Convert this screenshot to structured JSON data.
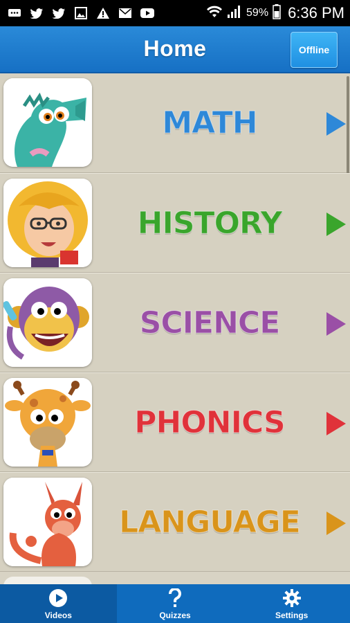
{
  "status_bar": {
    "icons": [
      "message-icon",
      "twitter-icon",
      "twitter-icon",
      "image-icon",
      "warning-icon",
      "mail-icon",
      "youtube-icon"
    ],
    "battery": "59%",
    "time": "6:36 PM"
  },
  "header": {
    "title": "Home",
    "offline_label": "Offline"
  },
  "subjects": [
    {
      "label": "MATH",
      "color": "#2e88d8",
      "icon": "seahorse-icon"
    },
    {
      "label": "HISTORY",
      "color": "#3aa52c",
      "icon": "teacher-icon"
    },
    {
      "label": "SCIENCE",
      "color": "#9a4fa6",
      "icon": "monkey-icon"
    },
    {
      "label": "PHONICS",
      "color": "#e0323a",
      "icon": "giraffe-icon"
    },
    {
      "label": "LANGUAGE",
      "color": "#d9941b",
      "icon": "kangaroo-icon"
    }
  ],
  "bottom_nav": {
    "tabs": [
      {
        "label": "Videos",
        "icon": "play-icon"
      },
      {
        "label": "Quizzes",
        "icon": "question-icon"
      },
      {
        "label": "Settings",
        "icon": "gear-icon"
      }
    ]
  }
}
